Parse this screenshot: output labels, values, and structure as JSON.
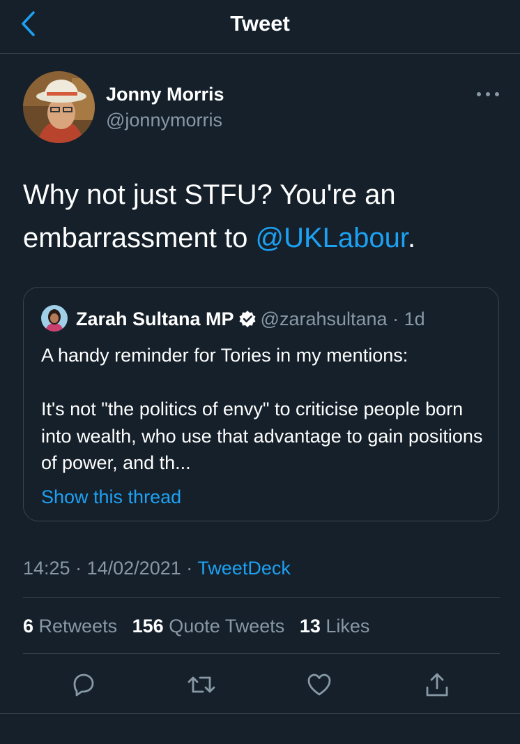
{
  "header": {
    "title": "Tweet",
    "back_icon": "chevron-left-icon",
    "accent_color": "#1da1f2"
  },
  "tweet": {
    "author": {
      "name": "Jonny Morris",
      "handle": "@jonnymorris"
    },
    "text_before": "Why not just STFU? You're an embarrassment to ",
    "mention": "@UKLabour",
    "text_after": ".",
    "quote": {
      "name": "Zarah Sultana MP",
      "verified": true,
      "handle": "@zarahsultana",
      "separator": "·",
      "age": "1d",
      "line1": "A handy reminder for Tories in my mentions:",
      "line2": "It's not \"the politics of envy\" to criticise people born into wealth, who use that advantage to gain positions of power, and th...",
      "show_thread": "Show this thread"
    },
    "time": "14:25",
    "dot": "·",
    "date": "14/02/2021",
    "source": "TweetDeck",
    "stats": {
      "retweets_count": "6",
      "retweets_label": "Retweets",
      "quotes_count": "156",
      "quotes_label": "Quote Tweets",
      "likes_count": "13",
      "likes_label": "Likes"
    }
  },
  "colors": {
    "background": "#15202b",
    "secondary_text": "#8899a6",
    "border": "#38444d",
    "link": "#1da1f2"
  }
}
